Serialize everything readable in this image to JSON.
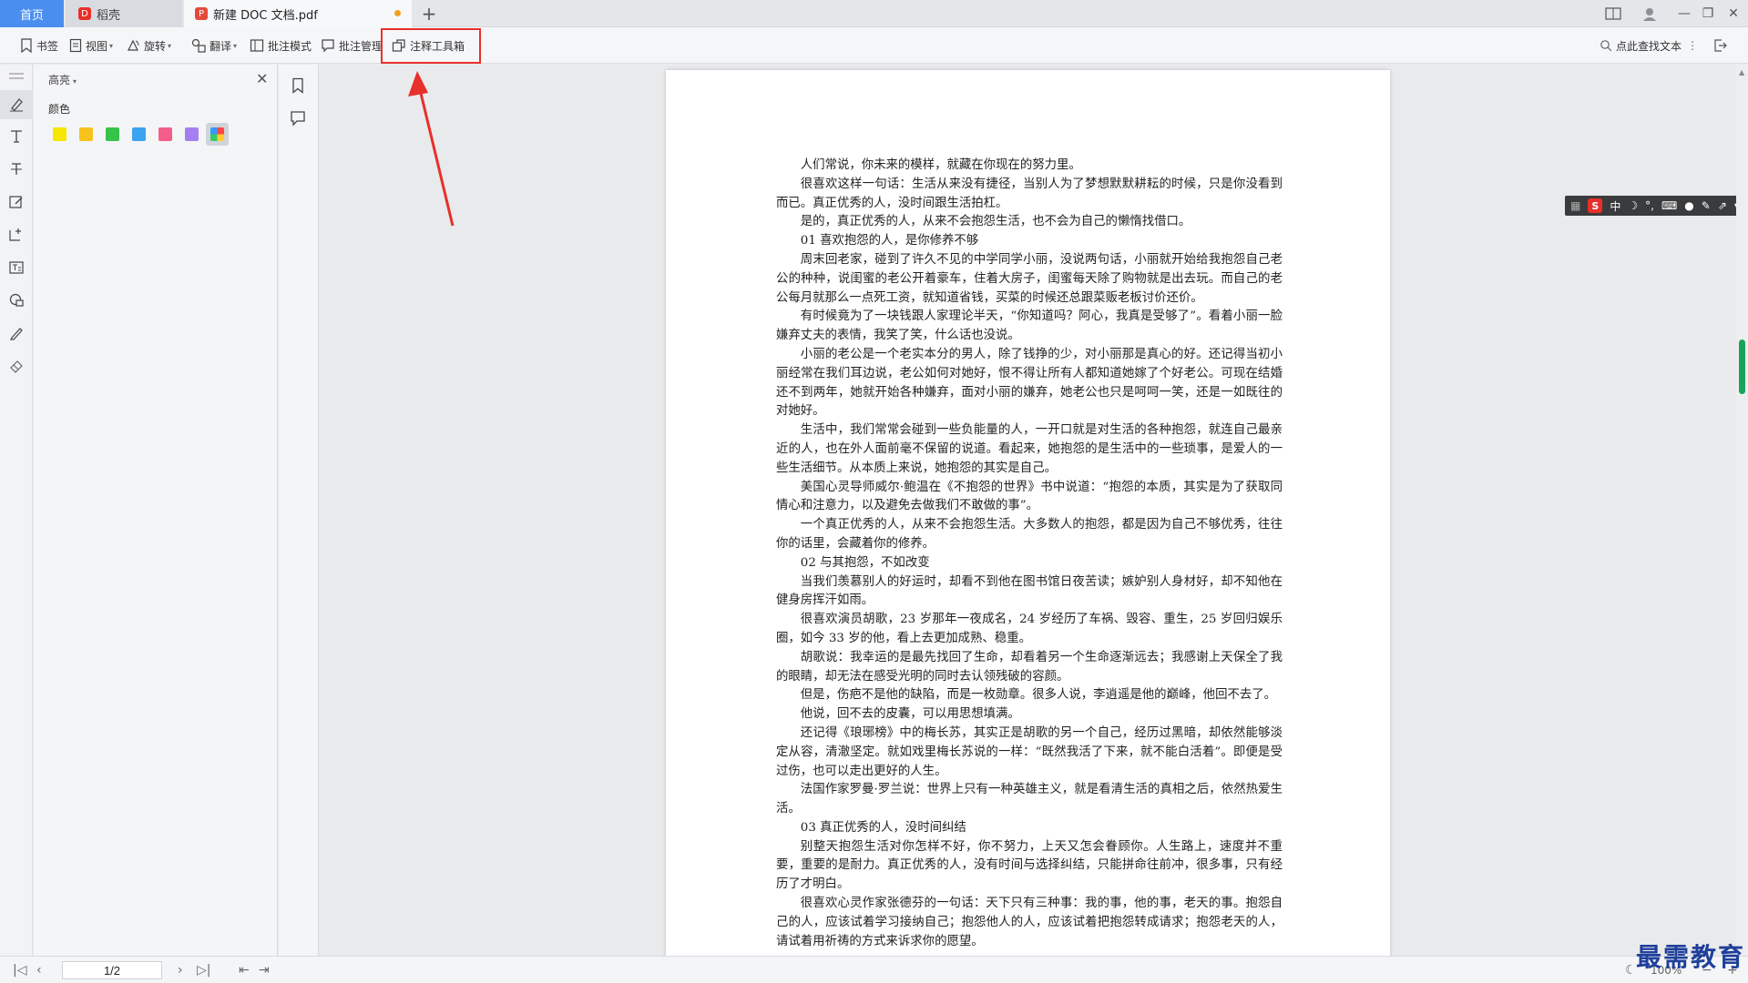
{
  "tabs": {
    "home": "首页",
    "daoke": "稻壳",
    "doc": "新建 DOC 文档.pdf"
  },
  "toolbar": {
    "bookmark": "书签",
    "view": "视图",
    "rotate": "旋转",
    "translate": "翻译",
    "annotate_mode": "批注模式",
    "annotate_manage": "批注管理",
    "annotate_toolbox": "注释工具箱",
    "search": "点此查找文本"
  },
  "panel": {
    "title": "高亮",
    "color_label": "颜色",
    "colors": [
      "#f7e600",
      "#f6c21c",
      "#37c24a",
      "#3ba3ef",
      "#f35e8a",
      "#a77ef0"
    ]
  },
  "document": {
    "paragraphs": [
      "人们常说，你未来的模样，就藏在你现在的努力里。",
      "很喜欢这样一句话：生活从来没有捷径，当别人为了梦想默默耕耘的时候，只是你没看到而已。真正优秀的人，没时间跟生活拍杠。",
      "是的，真正优秀的人，从来不会抱怨生活，也不会为自己的懒惰找借口。",
      "01  喜欢抱怨的人，是你修养不够",
      "周末回老家，碰到了许久不见的中学同学小丽，没说两句话，小丽就开始给我抱怨自己老公的种种，说闺蜜的老公开着豪车，住着大房子，闺蜜每天除了购物就是出去玩。而自己的老公每月就那么一点死工资，就知道省钱，买菜的时候还总跟菜贩老板讨价还价。",
      "有时候竟为了一块钱跟人家理论半天，“你知道吗？阿心，我真是受够了”。看着小丽一脸嫌弃丈夫的表情，我笑了笑，什么话也没说。",
      "小丽的老公是一个老实本分的男人，除了钱挣的少，对小丽那是真心的好。还记得当初小丽经常在我们耳边说，老公如何对她好，恨不得让所有人都知道她嫁了个好老公。可现在结婚还不到两年，她就开始各种嫌弃，面对小丽的嫌弃，她老公也只是呵呵一笑，还是一如既往的对她好。",
      "生活中，我们常常会碰到一些负能量的人，一开口就是对生活的各种抱怨，就连自己最亲近的人，也在外人面前毫不保留的说道。看起来，她抱怨的是生活中的一些琐事，是爱人的一些生活细节。从本质上来说，她抱怨的其实是自己。",
      "美国心灵导师威尔·鲍温在《不抱怨的世界》书中说道：“抱怨的本质，其实是为了获取同情心和注意力，以及避免去做我们不敢做的事”。",
      "一个真正优秀的人，从来不会抱怨生活。大多数人的抱怨，都是因为自己不够优秀，往往你的话里，会藏着你的修养。",
      "02  与其抱怨，不如改变",
      "当我们羡慕别人的好运时，却看不到他在图书馆日夜苦读；嫉妒别人身材好，却不知他在健身房挥汗如雨。",
      "很喜欢演员胡歌，23 岁那年一夜成名，24 岁经历了车祸、毁容、重生，25 岁回归娱乐圈，如今 33 岁的他，看上去更加成熟、稳重。",
      "胡歌说：我幸运的是最先找回了生命，却看着另一个生命逐渐远去；我感谢上天保全了我的眼睛，却无法在感受光明的同时去认领残破的容颜。",
      "但是，伤疤不是他的缺陷，而是一枚勋章。很多人说，李逍遥是他的巅峰，他回不去了。",
      "他说，回不去的皮囊，可以用思想填满。",
      "还记得《琅琊榜》中的梅长苏，其实正是胡歌的另一个自己，经历过黑暗，却依然能够淡定从容，清澈坚定。就如戏里梅长苏说的一样：“既然我活了下来，就不能白活着”。即便是受过伤，也可以走出更好的人生。",
      "法国作家罗曼·罗兰说：世界上只有一种英雄主义，就是看清生活的真相之后，依然热爱生活。",
      "03  真正优秀的人，没时间纠结",
      "别整天抱怨生活对你怎样不好，你不努力，上天又怎会眷顾你。人生路上，速度并不重要，重要的是耐力。真正优秀的人，没有时间与选择纠结，只能拼命往前冲，很多事，只有经历了才明白。",
      "很喜欢心灵作家张德芬的一句话：天下只有三种事：我的事，他的事，老天的事。抱怨自己的人，应该试着学习接纳自己；抱怨他人的人，应该试着把抱怨转成请求；抱怨老天的人，请试着用祈祷的方式来诉求你的愿望。"
    ]
  },
  "ime": {
    "mode": "中",
    "logo": "S"
  },
  "statusbar": {
    "page": "1/2",
    "zoom": "100%"
  },
  "watermark": "最需教育"
}
